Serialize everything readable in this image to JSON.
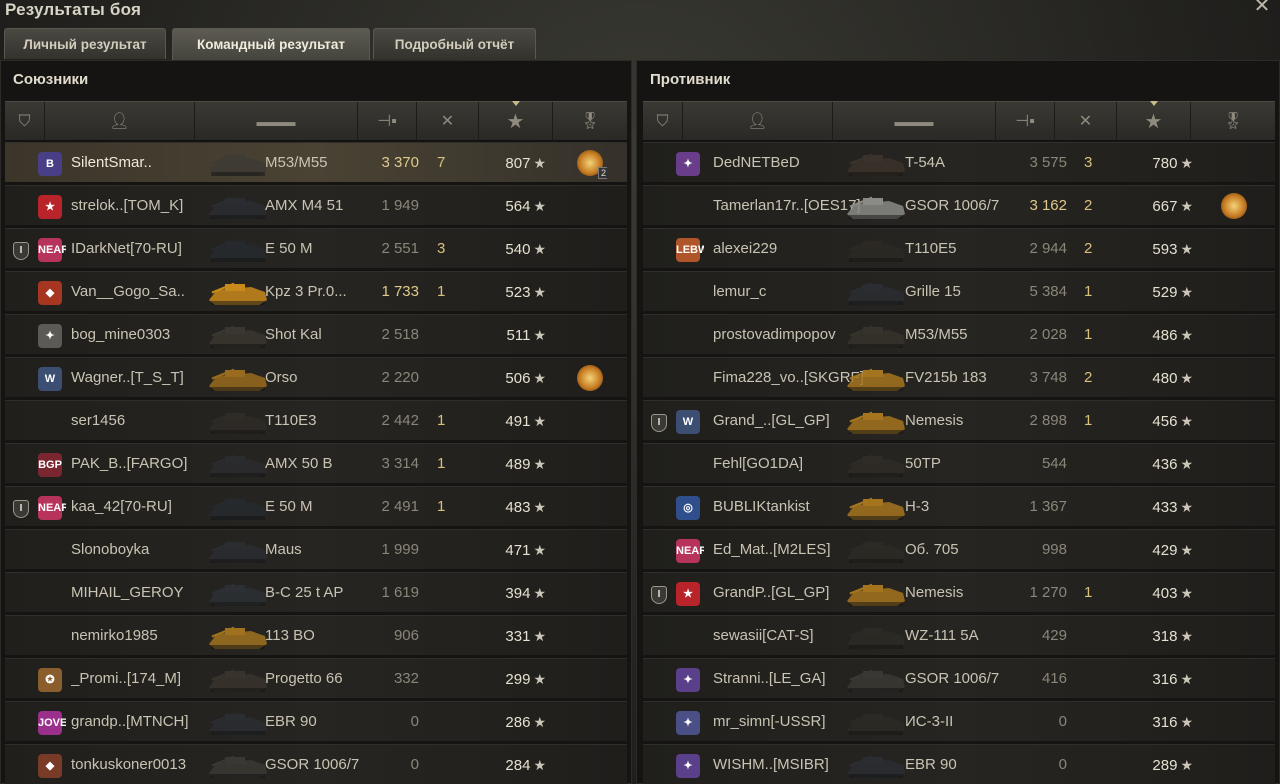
{
  "window": {
    "title": "Результаты боя",
    "close_label": "✕"
  },
  "tabs": [
    {
      "label": "Личный результат",
      "active": false
    },
    {
      "label": "Командный результат",
      "active": true
    },
    {
      "label": "Подробный отчёт",
      "active": false
    }
  ],
  "columns": {
    "icons": [
      "platoon-icon",
      "player-icon",
      "vehicle-icon",
      "damage-icon",
      "kills-icon",
      "experience-star-icon",
      "medal-icon"
    ],
    "sorted_by": "experience-star-icon"
  },
  "allies": {
    "title": "Союзники",
    "rows": [
      {
        "platoon": "",
        "badge": "B",
        "badge_color": "#4a3f86",
        "name": "SilentSmar..",
        "vehicle": "M53/M55",
        "damage": "3 370",
        "damage_gold": true,
        "kills": "7",
        "exp": "807",
        "medal": true,
        "medal_count": "2",
        "me": true,
        "tank_color": "#3e3b35"
      },
      {
        "platoon": "",
        "badge": "★",
        "badge_color": "#b8242a",
        "name": "strelok..[TOM_K]",
        "vehicle": "AMX M4 51",
        "damage": "1 949",
        "damage_gold": false,
        "kills": "",
        "exp": "564",
        "medal": false,
        "medal_count": "",
        "me": false,
        "tank_color": "#2a2d31"
      },
      {
        "platoon": "I",
        "badge": "NEAR",
        "badge_color": "#b7335b",
        "name": "IDarkNet[70-RU]",
        "vehicle": "E 50 M",
        "damage": "2 551",
        "damage_gold": false,
        "kills": "3",
        "exp": "540",
        "medal": false,
        "medal_count": "",
        "me": false,
        "tank_color": "#262a2e"
      },
      {
        "platoon": "",
        "badge": "◆",
        "badge_color": "#a6361f",
        "name": "Van__Gogo_Sa..",
        "vehicle": "Kpz 3 Pr.0...",
        "damage": "1 733",
        "damage_gold": true,
        "kills": "1",
        "exp": "523",
        "medal": false,
        "medal_count": "",
        "me": false,
        "tank_color": "#c98a1c"
      },
      {
        "platoon": "",
        "badge": "✦",
        "badge_color": "#5c5a55",
        "name": "bog_mine0303",
        "vehicle": "Shot Kal",
        "damage": "2 518",
        "damage_gold": false,
        "kills": "",
        "exp": "511",
        "medal": false,
        "medal_count": "",
        "me": false,
        "tank_color": "#3a3630"
      },
      {
        "platoon": "",
        "badge": "W",
        "badge_color": "#3c4f73",
        "name": "Wagner..[T_S_T]",
        "vehicle": "Orso",
        "damage": "2 220",
        "damage_gold": false,
        "kills": "",
        "exp": "506",
        "medal": true,
        "medal_count": "",
        "me": false,
        "tank_color": "#9a6b1e"
      },
      {
        "platoon": "",
        "badge": "",
        "badge_color": "",
        "name": "ser1456",
        "vehicle": "T110E3",
        "damage": "2 442",
        "damage_gold": false,
        "kills": "1",
        "exp": "491",
        "medal": false,
        "medal_count": "",
        "me": false,
        "tank_color": "#2f2c27"
      },
      {
        "platoon": "",
        "badge": "BGP",
        "badge_color": "#7a2630",
        "name": "PAK_B..[FARGO]",
        "vehicle": "AMX 50 B",
        "damage": "3 314",
        "damage_gold": false,
        "kills": "1",
        "exp": "489",
        "medal": false,
        "medal_count": "",
        "me": false,
        "tank_color": "#2b2c2f"
      },
      {
        "platoon": "I",
        "badge": "NEAR",
        "badge_color": "#b7335b",
        "name": "kaa_42[70-RU]",
        "vehicle": "E 50 M",
        "damage": "2 491",
        "damage_gold": false,
        "kills": "1",
        "exp": "483",
        "medal": false,
        "medal_count": "",
        "me": false,
        "tank_color": "#262a2e"
      },
      {
        "platoon": "",
        "badge": "",
        "badge_color": "",
        "name": "Slonoboyka",
        "vehicle": "Maus",
        "damage": "1 999",
        "damage_gold": false,
        "kills": "",
        "exp": "471",
        "medal": false,
        "medal_count": "",
        "me": false,
        "tank_color": "#2b2d31"
      },
      {
        "platoon": "",
        "badge": "",
        "badge_color": "",
        "name": "MIHAIL_GEROY",
        "vehicle": "B-C 25 t AP",
        "damage": "1 619",
        "damage_gold": false,
        "kills": "",
        "exp": "394",
        "medal": false,
        "medal_count": "",
        "me": false,
        "tank_color": "#2c3035"
      },
      {
        "platoon": "",
        "badge": "",
        "badge_color": "",
        "name": "nemirko1985",
        "vehicle": "113 BO",
        "damage": "906",
        "damage_gold": false,
        "kills": "",
        "exp": "331",
        "medal": false,
        "medal_count": "",
        "me": false,
        "tank_color": "#a07220"
      },
      {
        "platoon": "",
        "badge": "✪",
        "badge_color": "#8a5e2c",
        "name": "_Promi..[174_M]",
        "vehicle": "Progetto 66",
        "damage": "332",
        "damage_gold": false,
        "kills": "",
        "exp": "299",
        "medal": false,
        "medal_count": "",
        "me": false,
        "tank_color": "#38342d"
      },
      {
        "platoon": "",
        "badge": "JOVE",
        "badge_color": "#9a2f8c",
        "name": "grandp..[MTNCH]",
        "vehicle": "EBR 90",
        "damage": "0",
        "damage_gold": false,
        "kills": "",
        "exp": "286",
        "medal": false,
        "medal_count": "",
        "me": false,
        "tank_color": "#2a2d31"
      },
      {
        "platoon": "",
        "badge": "◆",
        "badge_color": "#7a3a28",
        "name": "tonkuskoner0013",
        "vehicle": "GSOR 1006/7",
        "damage": "0",
        "damage_gold": false,
        "kills": "",
        "exp": "284",
        "medal": false,
        "medal_count": "",
        "me": false,
        "tank_color": "#3a3834"
      }
    ]
  },
  "enemies": {
    "title": "Противник",
    "rows": [
      {
        "platoon": "",
        "badge": "✦",
        "badge_color": "#6a3d8a",
        "name": "DedNETBeD",
        "vehicle": "T-54A",
        "damage": "3 575",
        "damage_gold": false,
        "kills": "3",
        "exp": "780",
        "medal": false,
        "medal_count": "",
        "tank_color": "#3a332c"
      },
      {
        "platoon": "",
        "badge": "",
        "badge_color": "",
        "name": "Tamerlan17r..[OES17]",
        "vehicle": "GSOR 1006/7",
        "damage": "3 162",
        "damage_gold": true,
        "kills": "2",
        "exp": "667",
        "medal": true,
        "medal_count": "",
        "tank_color": "#8a8a86"
      },
      {
        "platoon": "",
        "badge": "LEBWA",
        "badge_color": "#b0542a",
        "name": "alexei229",
        "vehicle": "T110E5",
        "damage": "2 944",
        "damage_gold": false,
        "kills": "2",
        "exp": "593",
        "medal": false,
        "medal_count": "",
        "tank_color": "#2c2925"
      },
      {
        "platoon": "",
        "badge": "",
        "badge_color": "",
        "name": "lemur_c",
        "vehicle": "Grille 15",
        "damage": "5 384",
        "damage_gold": false,
        "kills": "1",
        "exp": "529",
        "medal": false,
        "medal_count": "",
        "tank_color": "#2a2d31"
      },
      {
        "platoon": "",
        "badge": "",
        "badge_color": "",
        "name": "prostovadimpopov",
        "vehicle": "M53/M55",
        "damage": "2 028",
        "damage_gold": false,
        "kills": "1",
        "exp": "486",
        "medal": false,
        "medal_count": "",
        "tank_color": "#36332d"
      },
      {
        "platoon": "",
        "badge": "",
        "badge_color": "",
        "name": "Fima228_vo..[SKGRF]",
        "vehicle": "FV215b 183",
        "damage": "3 748",
        "damage_gold": false,
        "kills": "2",
        "exp": "480",
        "medal": false,
        "medal_count": "",
        "tank_color": "#a5741f"
      },
      {
        "platoon": "I",
        "badge": "W",
        "badge_color": "#3c4f73",
        "name": "Grand_..[GL_GP]",
        "vehicle": "Nemesis",
        "damage": "2 898",
        "damage_gold": false,
        "kills": "1",
        "exp": "456",
        "medal": false,
        "medal_count": "",
        "tank_color": "#a5741f"
      },
      {
        "platoon": "",
        "badge": "",
        "badge_color": "",
        "name": "Fehl[GO1DA]",
        "vehicle": "50TP",
        "damage": "544",
        "damage_gold": false,
        "kills": "",
        "exp": "436",
        "medal": false,
        "medal_count": "",
        "tank_color": "#2f2c27"
      },
      {
        "platoon": "",
        "badge": "◎",
        "badge_color": "#2f4f8c",
        "name": "BUBLIKtankist",
        "vehicle": "H-3",
        "damage": "1 367",
        "damage_gold": false,
        "kills": "",
        "exp": "433",
        "medal": false,
        "medal_count": "",
        "tank_color": "#a5741f"
      },
      {
        "platoon": "",
        "badge": "NEAR",
        "badge_color": "#b7335b",
        "name": "Ed_Mat..[M2LES]",
        "vehicle": "Об. 705",
        "damage": "998",
        "damage_gold": false,
        "kills": "",
        "exp": "429",
        "medal": false,
        "medal_count": "",
        "tank_color": "#2c2a25"
      },
      {
        "platoon": "I",
        "badge": "★",
        "badge_color": "#b8242a",
        "name": "GrandP..[GL_GP]",
        "vehicle": "Nemesis",
        "damage": "1 270",
        "damage_gold": false,
        "kills": "1",
        "exp": "403",
        "medal": false,
        "medal_count": "",
        "tank_color": "#a5741f"
      },
      {
        "platoon": "",
        "badge": "",
        "badge_color": "",
        "name": "sewasii[CAT-S]",
        "vehicle": "WZ-111 5A",
        "damage": "429",
        "damage_gold": false,
        "kills": "",
        "exp": "318",
        "medal": false,
        "medal_count": "",
        "tank_color": "#2c2a25"
      },
      {
        "platoon": "",
        "badge": "✦",
        "badge_color": "#5a3f8a",
        "name": "Stranni..[LE_GA]",
        "vehicle": "GSOR 1006/7",
        "damage": "416",
        "damage_gold": false,
        "kills": "",
        "exp": "316",
        "medal": false,
        "medal_count": "",
        "tank_color": "#3a3834"
      },
      {
        "platoon": "",
        "badge": "✦",
        "badge_color": "#4a4f86",
        "name": "mr_simn[-USSR]",
        "vehicle": "ИС-3-II",
        "damage": "0",
        "damage_gold": false,
        "kills": "",
        "exp": "316",
        "medal": false,
        "medal_count": "",
        "tank_color": "#2c2a25"
      },
      {
        "platoon": "",
        "badge": "✦",
        "badge_color": "#5a3f8a",
        "name": "WISHM..[MSIBR]",
        "vehicle": "EBR 90",
        "damage": "0",
        "damage_gold": false,
        "kills": "",
        "exp": "289",
        "medal": false,
        "medal_count": "",
        "tank_color": "#2a2d31"
      }
    ]
  }
}
